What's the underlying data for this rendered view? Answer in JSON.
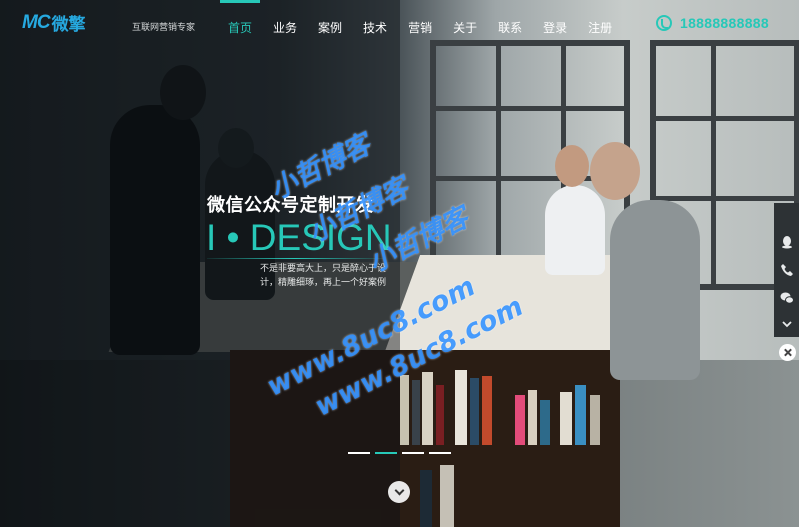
{
  "header": {
    "logo_mark": "MC",
    "logo_text": "微擎",
    "tagline": "互联网营销专家",
    "nav": [
      {
        "label": "首页",
        "active": true
      },
      {
        "label": "业务",
        "active": false
      },
      {
        "label": "案例",
        "active": false
      },
      {
        "label": "技术",
        "active": false
      },
      {
        "label": "营销",
        "active": false
      },
      {
        "label": "关于",
        "active": false
      },
      {
        "label": "联系",
        "active": false
      },
      {
        "label": "登录",
        "active": false
      },
      {
        "label": "注册",
        "active": false
      }
    ],
    "phone": "18888888888"
  },
  "hero": {
    "subtitle": "微信公众号定制开发",
    "title": "I • DESIGN",
    "description": "不是非要高大上，只是醉心于设计，精雕细琢，再上一个好案例"
  },
  "watermark": {
    "brand": "小哲博客",
    "url": "www.8uc8.com"
  },
  "slider": {
    "slides": 4,
    "active_index": 1
  },
  "float_bar": {
    "items": [
      "qq-icon",
      "phone-icon",
      "wechat-icon",
      "chevron-down-icon"
    ]
  },
  "colors": {
    "accent": "#27c8b8",
    "logo": "#26a9e0",
    "header_text": "#ffffff"
  }
}
